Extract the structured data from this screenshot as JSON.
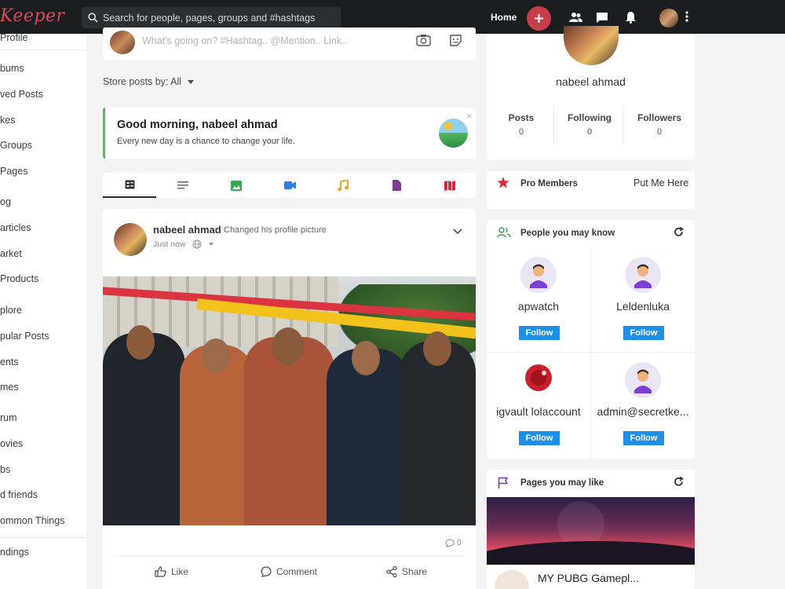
{
  "app": {
    "logo": "Keeper"
  },
  "topbar": {
    "search_placeholder": "Search for people, pages, groups and #hashtags",
    "home_label": "Home"
  },
  "sidebar": {
    "items": [
      {
        "label": "Profile"
      },
      {
        "label": "bums"
      },
      {
        "label": "ved Posts"
      },
      {
        "label": "kes"
      },
      {
        "label": "Groups"
      },
      {
        "label": "Pages"
      },
      {
        "label": "og"
      },
      {
        "label": "articles"
      },
      {
        "label": "arket"
      },
      {
        "label": "Products"
      },
      {
        "label": "plore"
      },
      {
        "label": "pular Posts"
      },
      {
        "label": "ents"
      },
      {
        "label": "mes"
      },
      {
        "label": "rum"
      },
      {
        "label": "ovies"
      },
      {
        "label": "bs"
      },
      {
        "label": "d friends"
      },
      {
        "label": "ommon Things"
      },
      {
        "label": "ndings"
      }
    ]
  },
  "composer": {
    "placeholder": "What's going on? #Hashtag.. @Mention.. Link.."
  },
  "store": {
    "label": "Store posts by: All"
  },
  "greeting": {
    "title": "Good morning, nabeel ahmad",
    "subtitle": "Every new day is a chance to change your life.",
    "close": "×"
  },
  "post": {
    "author": "nabeel ahmad",
    "action": "Changed his profile picture",
    "time": "Just now",
    "comment_count": "0",
    "like_label": "Like",
    "comment_label": "Comment",
    "share_label": "Share"
  },
  "profile": {
    "name": "nabeel ahmad",
    "stats": [
      {
        "label": "Posts",
        "value": "0"
      },
      {
        "label": "Following",
        "value": "0"
      },
      {
        "label": "Followers",
        "value": "0"
      }
    ]
  },
  "pro_members": {
    "title": "Pro Members",
    "link": "Put Me Here"
  },
  "people": {
    "title": "People you may know",
    "users": [
      {
        "name": "apwatch",
        "follow": "Follow",
        "avatar": "default"
      },
      {
        "name": "Leldenluka",
        "follow": "Follow",
        "avatar": "default"
      },
      {
        "name": "igvault lolaccount",
        "follow": "Follow",
        "avatar": "custom"
      },
      {
        "name": "admin@secretke...",
        "follow": "Follow",
        "avatar": "default"
      }
    ]
  },
  "pages": {
    "title": "Pages you may like",
    "page_name": "MY PUBG Gamepl..."
  },
  "colors": {
    "topbar_bg": "#1b1d1f",
    "accent_red": "#c63e49",
    "follow_blue": "#1d8fe6",
    "greeting_green": "#5cb85c"
  }
}
